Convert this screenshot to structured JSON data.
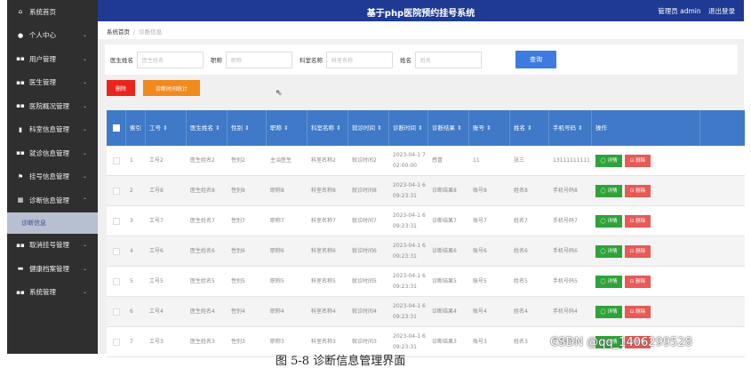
{
  "header": {
    "title": "基于php医院预约挂号系统",
    "user": "管理员 admin",
    "logout": "退出登录"
  },
  "sidebar": {
    "items": [
      {
        "icon": "home-icon",
        "glyph": "⌂",
        "label": "系统首页",
        "arrow": ""
      },
      {
        "icon": "user-icon",
        "glyph": "●",
        "label": "个人中心",
        "arrow": "⌄"
      },
      {
        "icon": "grid-icon",
        "glyph": "▪▪",
        "label": "用户管理",
        "arrow": "⌄"
      },
      {
        "icon": "grid-icon",
        "glyph": "▪▪",
        "label": "医生管理",
        "arrow": "⌄"
      },
      {
        "icon": "grid-icon",
        "glyph": "▪▪",
        "label": "医院概况管理",
        "arrow": "⌄"
      },
      {
        "icon": "doc-icon",
        "glyph": "▮",
        "label": "科室信息管理",
        "arrow": "⌄"
      },
      {
        "icon": "grid-icon",
        "glyph": "▪▪",
        "label": "就诊信息管理",
        "arrow": "⌄"
      },
      {
        "icon": "flag-icon",
        "glyph": "⚑",
        "label": "挂号信息管理",
        "arrow": "⌄"
      },
      {
        "icon": "grid-icon",
        "glyph": "▦",
        "label": "诊断信息管理",
        "arrow": "⌃"
      }
    ],
    "sub_item": "诊断信息",
    "items_after": [
      {
        "icon": "grid-icon",
        "glyph": "▪▪",
        "label": "取消挂号管理",
        "arrow": "⌄"
      },
      {
        "icon": "briefcase-icon",
        "glyph": "▬",
        "label": "健康档案管理",
        "arrow": "⌄"
      },
      {
        "icon": "grid-icon",
        "glyph": "▪▪",
        "label": "系统管理",
        "arrow": "⌄"
      }
    ]
  },
  "breadcrumb": {
    "home": "系统首页",
    "sep": "/",
    "current": "诊断信息"
  },
  "search": {
    "fields": [
      {
        "label": "医生姓名",
        "placeholder": "医生姓名",
        "width": 75
      },
      {
        "label": "职称",
        "placeholder": "职称",
        "width": 75
      },
      {
        "label": "科室名称",
        "placeholder": "科室名称",
        "width": 75
      },
      {
        "label": "姓名",
        "placeholder": "姓名",
        "width": 75
      }
    ],
    "query_label": "查询"
  },
  "actions": {
    "delete_label": "删除",
    "stat_label": "诊断时间统计"
  },
  "table": {
    "headers": [
      "",
      "索引",
      "工号 ⇕",
      "医生姓名 ⇕",
      "性别 ⇕",
      "职称 ⇕",
      "科室名称 ⇕",
      "就诊时间 ⇕",
      "诊断时间 ⇕",
      "诊断结果 ⇕",
      "账号 ⇕",
      "姓名 ⇕",
      "手机号码 ⇕",
      "操作"
    ],
    "detail_label": "◯ 详情",
    "remove_label": "⊡ 删除",
    "rows": [
      [
        "1",
        "工号2",
        "医生姓名2",
        "性别2",
        "主治医生",
        "科室名称2",
        "就诊时间2",
        "2023-04-1 7 02:00:00",
        "感冒",
        "11",
        "张三",
        "13111111111"
      ],
      [
        "2",
        "工号8",
        "医生姓名8",
        "性别8",
        "职称8",
        "科室名称8",
        "就诊时间8",
        "2023-04-1 6 09:23:31",
        "诊断结果8",
        "账号8",
        "姓名8",
        "手机号码8"
      ],
      [
        "3",
        "工号7",
        "医生姓名7",
        "性别7",
        "职称7",
        "科室名称7",
        "就诊时间7",
        "2023-04-1 6 09:23:31",
        "诊断结果7",
        "账号7",
        "姓名7",
        "手机号码7"
      ],
      [
        "4",
        "工号6",
        "医生姓名6",
        "性别6",
        "职称6",
        "科室名称6",
        "就诊时间6",
        "2023-04-1 6 09:23:31",
        "诊断结果6",
        "账号6",
        "姓名6",
        "手机号码6"
      ],
      [
        "5",
        "工号5",
        "医生姓名5",
        "性别5",
        "职称5",
        "科室名称5",
        "就诊时间5",
        "2023-04-1 6 09:23:31",
        "诊断结果5",
        "账号5",
        "姓名5",
        "手机号码5"
      ],
      [
        "6",
        "工号4",
        "医生姓名4",
        "性别4",
        "职称4",
        "科室名称4",
        "就诊时间4",
        "2023-04-1 6 09:23:31",
        "诊断结果4",
        "账号4",
        "姓名4",
        "手机号码4"
      ],
      [
        "7",
        "工号3",
        "医生姓名3",
        "性别3",
        "职称3",
        "科室名称3",
        "就诊时间3",
        "2023-04-1 6 09:23:31",
        "诊断结果3",
        "账号3",
        "姓名3",
        "手机号码3"
      ]
    ]
  },
  "watermark": "CSDN @qq_1406299528",
  "caption": "图 5-8 诊断信息管理界面",
  "colors": {
    "header": "#1f3a93",
    "sidebar": "#2f2f2f",
    "table_head": "#3f79c8",
    "query": "#3d7be0",
    "delete": "#e8261d",
    "stat": "#f08a1e",
    "detail": "#2ea33a",
    "remove": "#e75a56"
  }
}
